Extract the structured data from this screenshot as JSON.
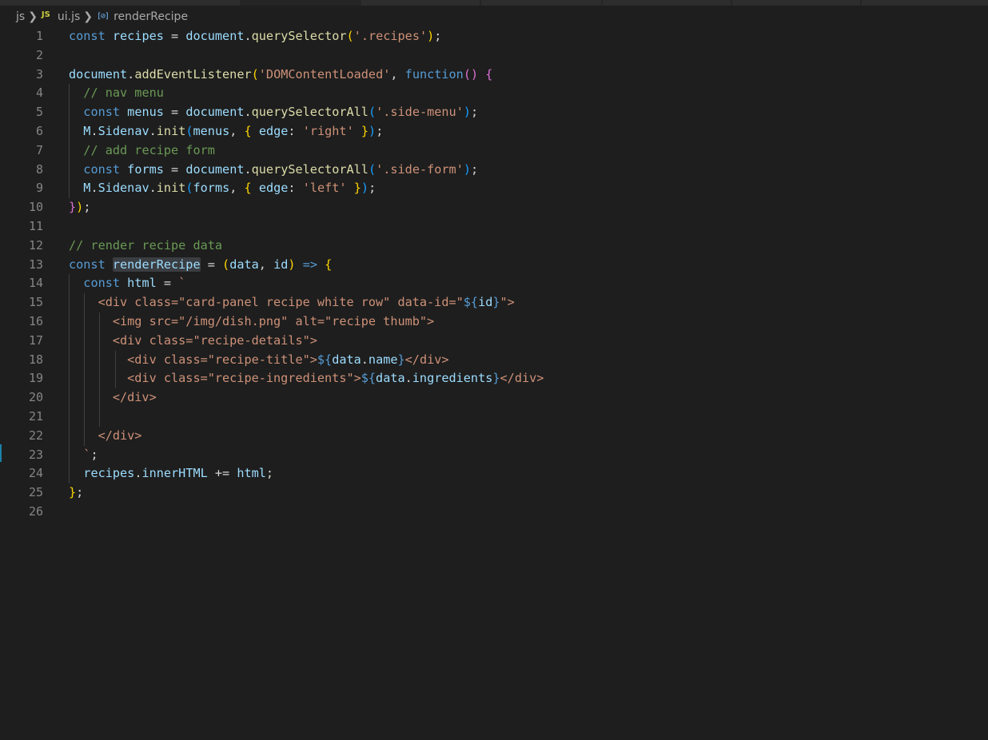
{
  "breadcrumb": {
    "folder": "js",
    "file_icon": "JS",
    "file": "ui.js",
    "symbol_icon": "[⊘]",
    "symbol": "renderRecipe"
  },
  "editor": {
    "language": "javascript",
    "lines": [
      {
        "number": "1",
        "text": "const recipes = document.querySelector('.recipes');"
      },
      {
        "number": "2",
        "text": ""
      },
      {
        "number": "3",
        "text": "document.addEventListener('DOMContentLoaded', function() {"
      },
      {
        "number": "4",
        "text": "  // nav menu"
      },
      {
        "number": "5",
        "text": "  const menus = document.querySelectorAll('.side-menu');"
      },
      {
        "number": "6",
        "text": "  M.Sidenav.init(menus, { edge: 'right' });"
      },
      {
        "number": "7",
        "text": "  // add recipe form"
      },
      {
        "number": "8",
        "text": "  const forms = document.querySelectorAll('.side-form');"
      },
      {
        "number": "9",
        "text": "  M.Sidenav.init(forms, { edge: 'left' });"
      },
      {
        "number": "10",
        "text": "});"
      },
      {
        "number": "11",
        "text": ""
      },
      {
        "number": "12",
        "text": "// render recipe data"
      },
      {
        "number": "13",
        "text": "const renderRecipe = (data, id) => {"
      },
      {
        "number": "14",
        "text": "  const html = `"
      },
      {
        "number": "15",
        "text": "    <div class=\"card-panel recipe white row\" data-id=\"${id}\">"
      },
      {
        "number": "16",
        "text": "      <img src=\"/img/dish.png\" alt=\"recipe thumb\">"
      },
      {
        "number": "17",
        "text": "      <div class=\"recipe-details\">"
      },
      {
        "number": "18",
        "text": "        <div class=\"recipe-title\">${data.name}</div>"
      },
      {
        "number": "19",
        "text": "        <div class=\"recipe-ingredients\">${data.ingredients}</div>"
      },
      {
        "number": "20",
        "text": "      </div>"
      },
      {
        "number": "21",
        "text": ""
      },
      {
        "number": "22",
        "text": "    </div>"
      },
      {
        "number": "23",
        "text": "  `;"
      },
      {
        "number": "24",
        "text": "  recipes.innerHTML += html;"
      },
      {
        "number": "25",
        "text": "};"
      },
      {
        "number": "26",
        "text": ""
      }
    ]
  },
  "colors": {
    "background": "#1e1e1e",
    "keyword": "#569cd6",
    "variable": "#9cdcfe",
    "function": "#dcdcaa",
    "string": "#ce9178",
    "comment": "#6a9955",
    "line_number": "#858585"
  }
}
